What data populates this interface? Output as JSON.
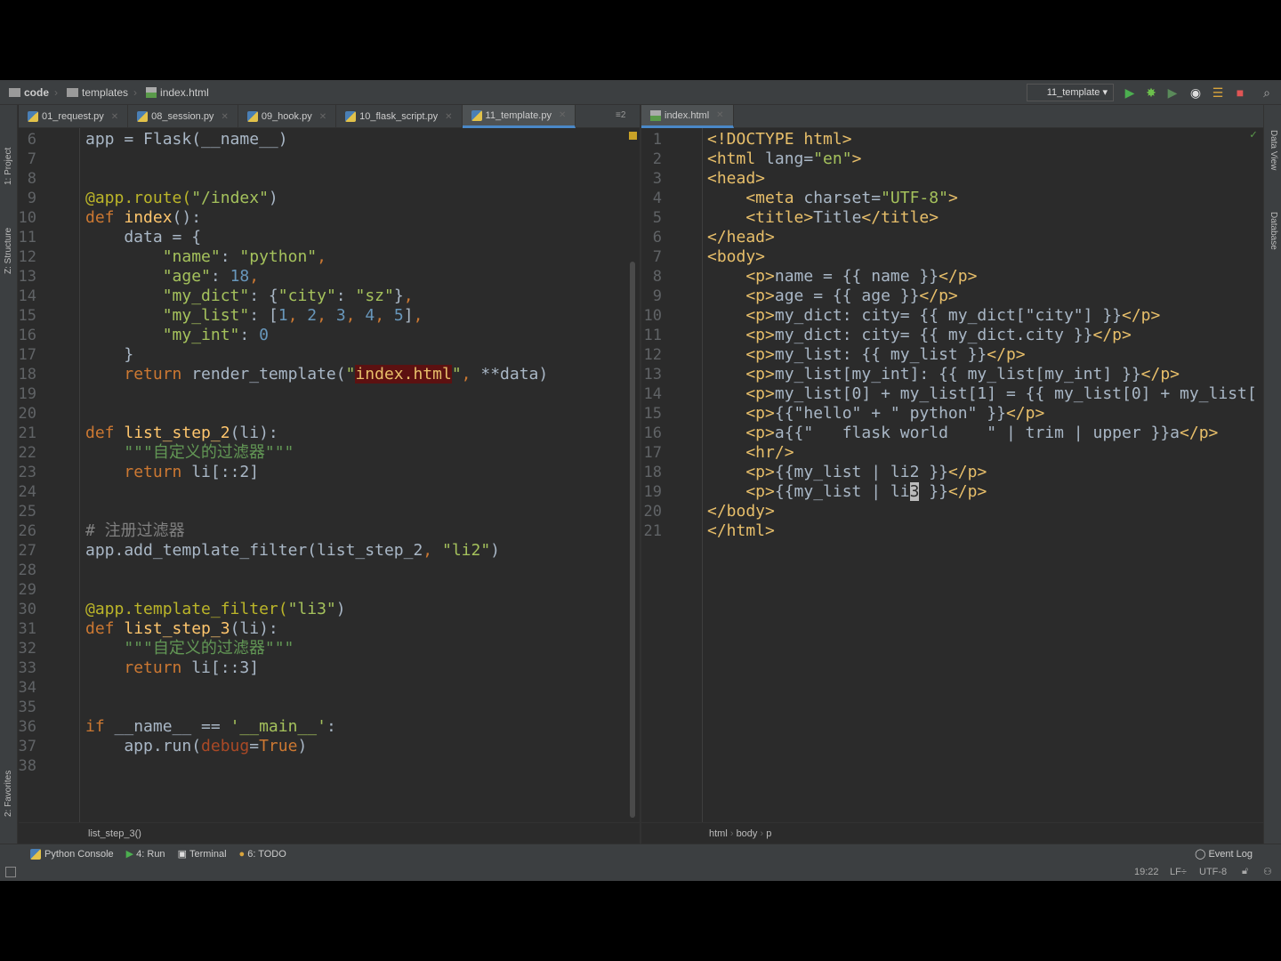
{
  "navbar": {
    "crumbs": [
      "code",
      "templates",
      "index.html"
    ],
    "run_config": "11_template"
  },
  "left_strip": {
    "project": "1: Project",
    "structure": "Z: Structure",
    "favorites": "2: Favorites"
  },
  "right_strip": {
    "data_view": "Data View",
    "database": "Database"
  },
  "left_tabs": [
    {
      "label": "01_request.py"
    },
    {
      "label": "08_session.py"
    },
    {
      "label": "09_hook.py"
    },
    {
      "label": "10_flask_script.py"
    },
    {
      "label": "11_template.py",
      "active": true
    }
  ],
  "tab_overflow": "≡2",
  "right_tabs": [
    {
      "label": "index.html",
      "active": true
    }
  ],
  "left_code": {
    "start": 6,
    "lines": [
      [
        [
          "app = Flask(__name__)",
          "p"
        ]
      ],
      [],
      [],
      [
        [
          "@app.route(",
          "d"
        ],
        [
          "\"/index\"",
          "s"
        ],
        [
          ")",
          "p"
        ]
      ],
      [
        [
          "def ",
          "k"
        ],
        [
          "index",
          "fn"
        ],
        [
          "():",
          "p"
        ]
      ],
      [
        [
          "    data = {",
          "p"
        ]
      ],
      [
        [
          "        ",
          "p"
        ],
        [
          "\"name\"",
          "s"
        ],
        [
          ": ",
          "p"
        ],
        [
          "\"python\"",
          "s"
        ],
        [
          ",",
          "k"
        ]
      ],
      [
        [
          "        ",
          "p"
        ],
        [
          "\"age\"",
          "s"
        ],
        [
          ": ",
          "p"
        ],
        [
          "18",
          "n"
        ],
        [
          ",",
          "k"
        ]
      ],
      [
        [
          "        ",
          "p"
        ],
        [
          "\"my_dict\"",
          "s"
        ],
        [
          ": {",
          "p"
        ],
        [
          "\"city\"",
          "s"
        ],
        [
          ": ",
          "p"
        ],
        [
          "\"sz\"",
          "s"
        ],
        [
          "}",
          "p"
        ],
        [
          ",",
          "k"
        ]
      ],
      [
        [
          "        ",
          "p"
        ],
        [
          "\"my_list\"",
          "s"
        ],
        [
          ": [",
          "p"
        ],
        [
          "1",
          "n"
        ],
        [
          ", ",
          "k"
        ],
        [
          "2",
          "n"
        ],
        [
          ", ",
          "k"
        ],
        [
          "3",
          "n"
        ],
        [
          ", ",
          "k"
        ],
        [
          "4",
          "n"
        ],
        [
          ", ",
          "k"
        ],
        [
          "5",
          "n"
        ],
        [
          "]",
          "p"
        ],
        [
          ",",
          "k"
        ]
      ],
      [
        [
          "        ",
          "p"
        ],
        [
          "\"my_int\"",
          "s"
        ],
        [
          ": ",
          "p"
        ],
        [
          "0",
          "n"
        ]
      ],
      [
        [
          "    }",
          "p"
        ]
      ],
      [
        [
          "    ",
          "p"
        ],
        [
          "return ",
          "k"
        ],
        [
          "render_template(",
          "p"
        ],
        [
          "\"",
          "s"
        ],
        [
          "index.html",
          "hl"
        ],
        [
          "\"",
          "s"
        ],
        [
          ", ",
          "k"
        ],
        [
          "**data)",
          "p"
        ]
      ],
      [],
      [],
      [
        [
          "def ",
          "k"
        ],
        [
          "list_step_2",
          "fn"
        ],
        [
          "(li):",
          "p"
        ]
      ],
      [
        [
          "    \"\"\"自定义的过滤器\"\"\"",
          "doc"
        ]
      ],
      [
        [
          "    ",
          "p"
        ],
        [
          "return ",
          "k"
        ],
        [
          "li[::2]",
          "p"
        ]
      ],
      [],
      [],
      [
        [
          "# 注册过滤器",
          "c"
        ]
      ],
      [
        [
          "app.add_template_filter(list_step_2",
          "p"
        ],
        [
          ", ",
          "k"
        ],
        [
          "\"li2\"",
          "s"
        ],
        [
          ")",
          "p"
        ]
      ],
      [],
      [],
      [
        [
          "@app.template_filter(",
          "d"
        ],
        [
          "\"li3\"",
          "s"
        ],
        [
          ")",
          "p"
        ]
      ],
      [
        [
          "def ",
          "k"
        ],
        [
          "list_step_3",
          "fn"
        ],
        [
          "(li):",
          "p"
        ]
      ],
      [
        [
          "    \"\"\"自定义的过滤器\"\"\"",
          "doc"
        ]
      ],
      [
        [
          "    ",
          "p"
        ],
        [
          "return ",
          "k"
        ],
        [
          "li[::3]",
          "p"
        ]
      ],
      [],
      [],
      [
        [
          "if ",
          "k"
        ],
        [
          "__name__ == ",
          "p"
        ],
        [
          "'__main__'",
          "s"
        ],
        [
          ":",
          "p"
        ]
      ],
      [
        [
          "    app.run(",
          "p"
        ],
        [
          "debug",
          "pa"
        ],
        [
          "=",
          "p"
        ],
        [
          "True",
          "k"
        ],
        [
          ")",
          "p"
        ]
      ],
      []
    ]
  },
  "right_code": {
    "start": 1,
    "lines": [
      [
        [
          "<!DOCTYPE ",
          "t"
        ],
        [
          "html",
          "t"
        ],
        [
          ">",
          "t"
        ]
      ],
      [
        [
          "<html ",
          "t"
        ],
        [
          "lang=",
          "p"
        ],
        [
          "\"en\"",
          "s"
        ],
        [
          ">",
          "t"
        ]
      ],
      [
        [
          "<head>",
          "t"
        ]
      ],
      [
        [
          "    <meta ",
          "t"
        ],
        [
          "charset=",
          "p"
        ],
        [
          "\"UTF-8\"",
          "s"
        ],
        [
          ">",
          "t"
        ]
      ],
      [
        [
          "    <title>",
          "t"
        ],
        [
          "Title",
          "p"
        ],
        [
          "</title>",
          "t"
        ]
      ],
      [
        [
          "</head>",
          "t"
        ]
      ],
      [
        [
          "<body>",
          "t"
        ]
      ],
      [
        [
          "    <p>",
          "t"
        ],
        [
          "name = {{ name }}",
          "p"
        ],
        [
          "</p>",
          "t"
        ]
      ],
      [
        [
          "    <p>",
          "t"
        ],
        [
          "age = {{ age }}",
          "p"
        ],
        [
          "</p>",
          "t"
        ]
      ],
      [
        [
          "    <p>",
          "t"
        ],
        [
          "my_dict: city= {{ my_dict[\"city\"] }}",
          "p"
        ],
        [
          "</p>",
          "t"
        ]
      ],
      [
        [
          "    <p>",
          "t"
        ],
        [
          "my_dict: city= {{ my_dict.city }}",
          "p"
        ],
        [
          "</p>",
          "t"
        ]
      ],
      [
        [
          "    <p>",
          "t"
        ],
        [
          "my_list: {{ my_list }}",
          "p"
        ],
        [
          "</p>",
          "t"
        ]
      ],
      [
        [
          "    <p>",
          "t"
        ],
        [
          "my_list[my_int]: {{ my_list[my_int] }}",
          "p"
        ],
        [
          "</p>",
          "t"
        ]
      ],
      [
        [
          "    <p>",
          "t"
        ],
        [
          "my_list[0] + my_list[1] = {{ my_list[0] + my_list[",
          "p"
        ]
      ],
      [
        [
          "    <p>",
          "t"
        ],
        [
          "{{\"hello\" + \" python\" }}",
          "p"
        ],
        [
          "</p>",
          "t"
        ]
      ],
      [
        [
          "    <p>",
          "t"
        ],
        [
          "a{{\"   flask world    \" | trim | upper }}a",
          "p"
        ],
        [
          "</p>",
          "t"
        ]
      ],
      [
        [
          "    <hr/>",
          "t"
        ]
      ],
      [
        [
          "    <p>",
          "t"
        ],
        [
          "{{my_list | li2 }}",
          "p"
        ],
        [
          "</p>",
          "t"
        ]
      ],
      [
        [
          "    <p>",
          "t"
        ],
        [
          "{{my_list | li",
          "p"
        ],
        [
          "3",
          "cur"
        ],
        [
          " }}",
          "p"
        ],
        [
          "</p>",
          "t"
        ]
      ],
      [
        [
          "</body>",
          "t"
        ]
      ],
      [
        [
          "</html>",
          "t"
        ]
      ]
    ]
  },
  "left_breadcrumb": "list_step_3()",
  "right_breadcrumb": [
    "html",
    "body",
    "p"
  ],
  "tool_windows": [
    "Python Console",
    "4: Run",
    "Terminal",
    "6: TODO"
  ],
  "event_log": "Event Log",
  "status": {
    "position": "19:22",
    "line_sep": "LF÷",
    "encoding": "UTF-8"
  },
  "colors": {
    "keyword": "#cc7832",
    "string": "#a5c25c",
    "number": "#6897bb",
    "tag": "#e8bf6a",
    "background": "#2b2b2b"
  }
}
